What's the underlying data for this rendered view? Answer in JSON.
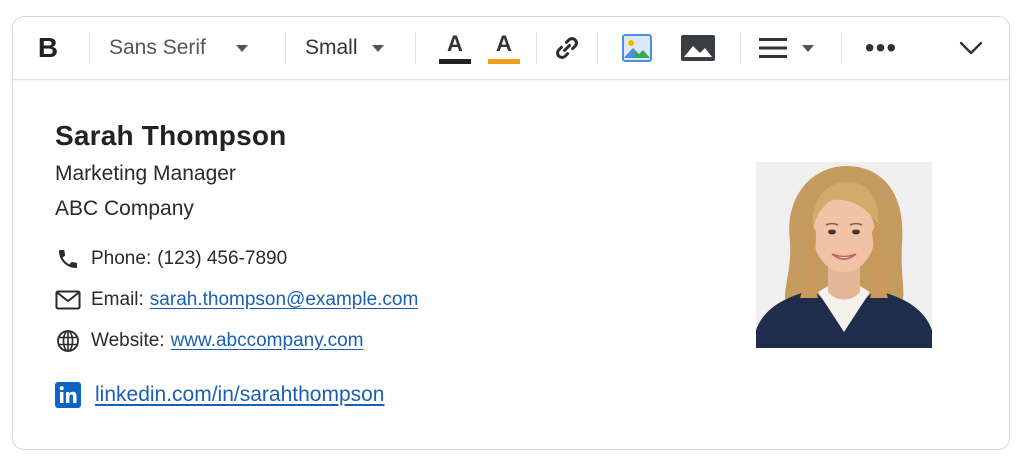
{
  "toolbar": {
    "bold_label": "B",
    "font_family": "Sans Serif",
    "font_size": "Small",
    "text_color_letter": "A",
    "text_color": "#222222",
    "highlight_letter": "A",
    "highlight_color": "#f0a020",
    "more_label": "•••"
  },
  "signature": {
    "name": "Sarah Thompson",
    "title": "Marketing Manager",
    "company": "ABC Company",
    "phone_label": "Phone:",
    "phone_value": "(123) 456-7890",
    "email_label": "Email:",
    "email_value": "sarah.thompson@example.com",
    "website_label": "Website:",
    "website_value": "www.abccompany.com",
    "linkedin_value": "linkedin.com/in/sarahthompson"
  },
  "colors": {
    "link": "#1a5fb4",
    "linkedin_brand": "#0a66c2",
    "image_icon_accent": "#4a90e2"
  },
  "icons": {
    "phone": "phone-icon",
    "email": "envelope-icon",
    "website": "globe-icon",
    "linkedin": "linkedin-icon",
    "link": "chain-link-icon",
    "insert_image": "insert-image-icon",
    "photo": "photo-icon",
    "align": "align-icon",
    "collapse": "chevron-down-icon"
  }
}
